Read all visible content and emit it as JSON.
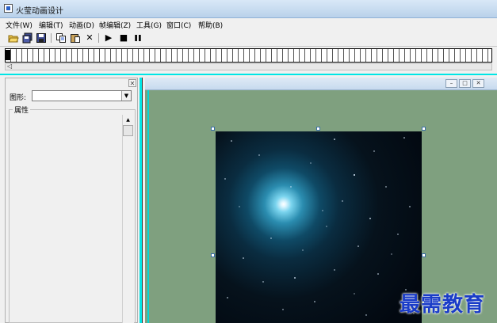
{
  "window": {
    "title": "火莹动画设计"
  },
  "menu": [
    {
      "label": "文件(W)"
    },
    {
      "label": "编辑(T)"
    },
    {
      "label": "动画(D)"
    },
    {
      "label": "帧编辑(Z)"
    },
    {
      "label": "工具(G)"
    },
    {
      "label": "窗口(C)"
    },
    {
      "label": "帮助(B)"
    }
  ],
  "toolbar": {
    "icons": [
      "open-folder-icon",
      "save-all-icon",
      "save-icon",
      "copy-icon",
      "paste-icon",
      "delete-icon",
      "play-icon",
      "stop-icon",
      "pause-icon"
    ],
    "delete_glyph": "✕",
    "play_glyph": "▶",
    "stop_glyph": "■",
    "pause_glyph": "❚❚"
  },
  "timeline": {
    "scroll_glyph": "◁"
  },
  "panel": {
    "close_glyph": "✕",
    "shape_label": "图形:",
    "shape_value": "",
    "properties_legend": "属性"
  },
  "document": {
    "min_glyph": "–",
    "max_glyph": "□",
    "close_glyph": "✕"
  },
  "watermark": "最需教育",
  "colors": {
    "canvas": "#7fa07f",
    "accent": "#00e6e6",
    "watermark": "#1a3cc8"
  }
}
